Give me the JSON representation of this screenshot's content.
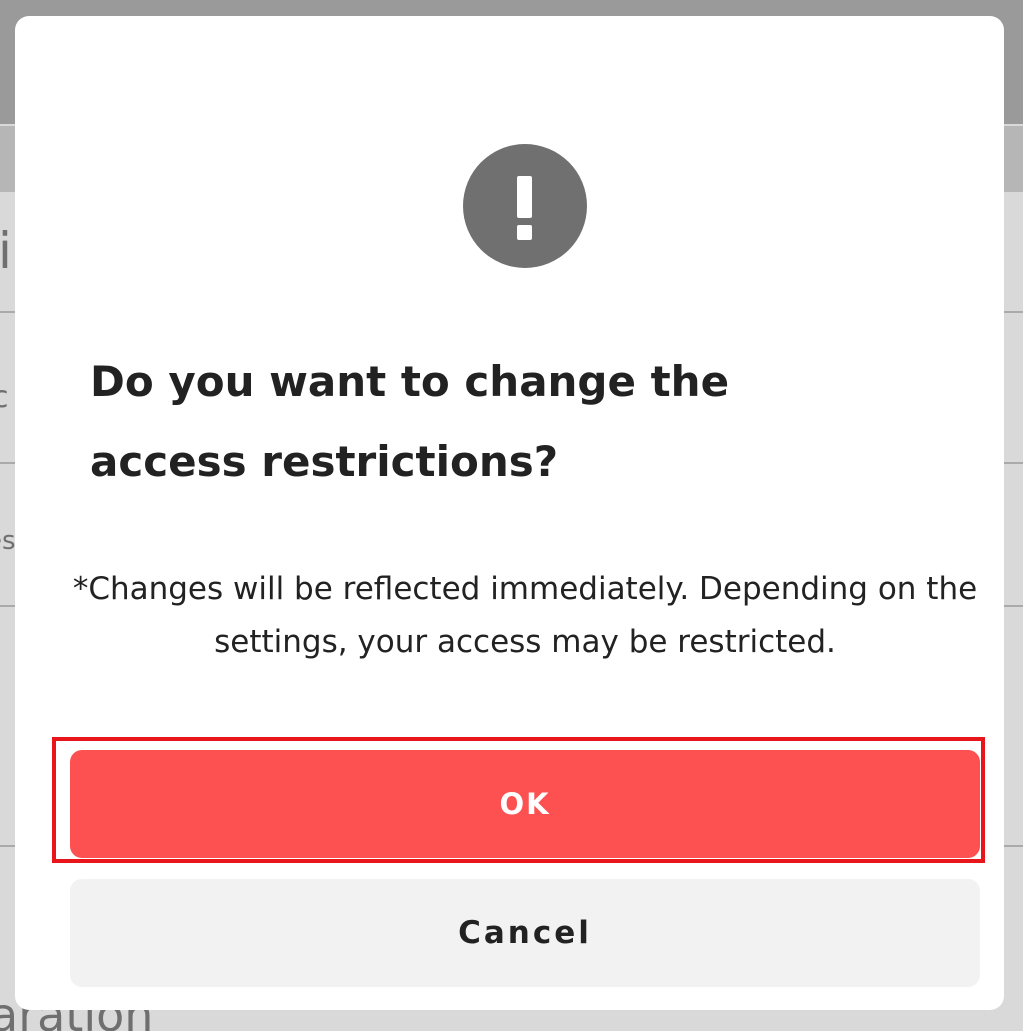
{
  "dialog": {
    "title": "Do you want to change the access restrictions?",
    "note": "*Changes will be reflected immediately. Depending on the settings, your access may be restricted.",
    "icon": "exclamation-circle-icon",
    "ok_label": "OK",
    "cancel_label": "Cancel"
  },
  "background": {
    "fragment_1": "i",
    "fragment_2": "c",
    "fragment_3": "es",
    "fragment_4": "aration"
  },
  "colors": {
    "ok_button": "#fd5050",
    "cancel_button": "#f2f2f2",
    "icon_circle": "#707070",
    "highlight": "#e8161b"
  }
}
